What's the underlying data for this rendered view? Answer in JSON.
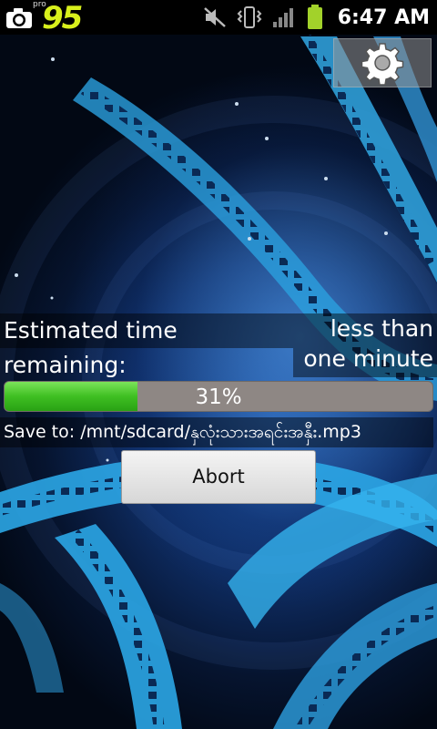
{
  "status_bar": {
    "app_badge_small": "pro",
    "app_badge_number": "95",
    "time": "6:47 AM",
    "icons": [
      "camera-icon",
      "mute-icon",
      "vibrate-icon",
      "signal-icon",
      "battery-icon"
    ]
  },
  "dialog": {
    "estimated_label": "Estimated time remaining:",
    "estimated_value_line1": "less than",
    "estimated_value_line2": "one minute",
    "progress_percent": 31,
    "progress_text": "31%",
    "save_to": "Save to: /mnt/sdcard/နှလုံးသားအရင်းအနှီး.mp3",
    "abort_label": "Abort"
  },
  "toolbar": {
    "settings_icon": "gear-icon"
  },
  "colors": {
    "progress_fill": "#3fbf22",
    "progress_track": "#8e8784",
    "app_badge": "#d8f01c",
    "battery": "#a2d22a"
  }
}
